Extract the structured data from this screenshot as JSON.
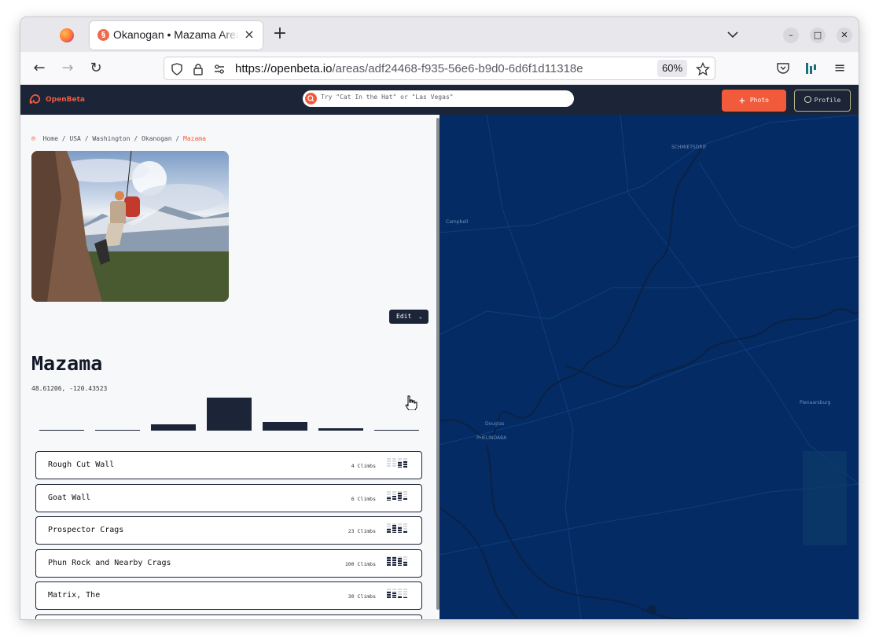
{
  "browser": {
    "tab_title": "Okanogan • Mazama Area",
    "tab_close": "×",
    "new_tab": "+",
    "url_host": "https://openbeta.io",
    "url_path": "/areas/adf24468-f935-56e6-b9d0-6d6f1d11318e",
    "zoom": "60%"
  },
  "header": {
    "logo_text": "OpenBeta",
    "search_placeholder": "Try \"Cat In the Hat\" or \"Las Vegas\"",
    "photo_label": "Photo",
    "profile_label": "Profile"
  },
  "breadcrumb": {
    "items": [
      "Home",
      "USA",
      "Washington",
      "Okanogan"
    ],
    "current": "Mazama",
    "separator": "/"
  },
  "area": {
    "edit_label": "Edit",
    "title": "Mazama",
    "coordinates": "48.61206, -120.43523"
  },
  "grade_histogram": [
    0.02,
    0.02,
    0.2,
    1.0,
    0.27,
    0.06,
    0.01
  ],
  "subareas": [
    {
      "name": "Rough Cut Wall",
      "count": "4 Climbs",
      "levels": [
        0,
        0,
        0.6,
        0.7
      ]
    },
    {
      "name": "Goat Wall",
      "count": "6 Climbs",
      "levels": [
        0.3,
        0.5,
        0.8,
        0.2
      ]
    },
    {
      "name": "Prospector Crags",
      "count": "23 Climbs",
      "levels": [
        0.4,
        0.8,
        0.6,
        0.2
      ]
    },
    {
      "name": "Phun Rock and Nearby Crags",
      "count": "100 Climbs",
      "levels": [
        0.9,
        0.9,
        0.8,
        0.4
      ]
    },
    {
      "name": "Matrix, The",
      "count": "30 Climbs",
      "levels": [
        0.7,
        0.6,
        0.2,
        0.1
      ]
    }
  ],
  "map": {
    "labels": [
      "SCHMIETSDRIF",
      "Campbell",
      "Douglas",
      "PHELINDABA",
      "Pienaarsburg"
    ]
  },
  "colors": {
    "brand": "#f15a3a",
    "header_bg": "#1c2438",
    "map_bg": "#042b63"
  }
}
